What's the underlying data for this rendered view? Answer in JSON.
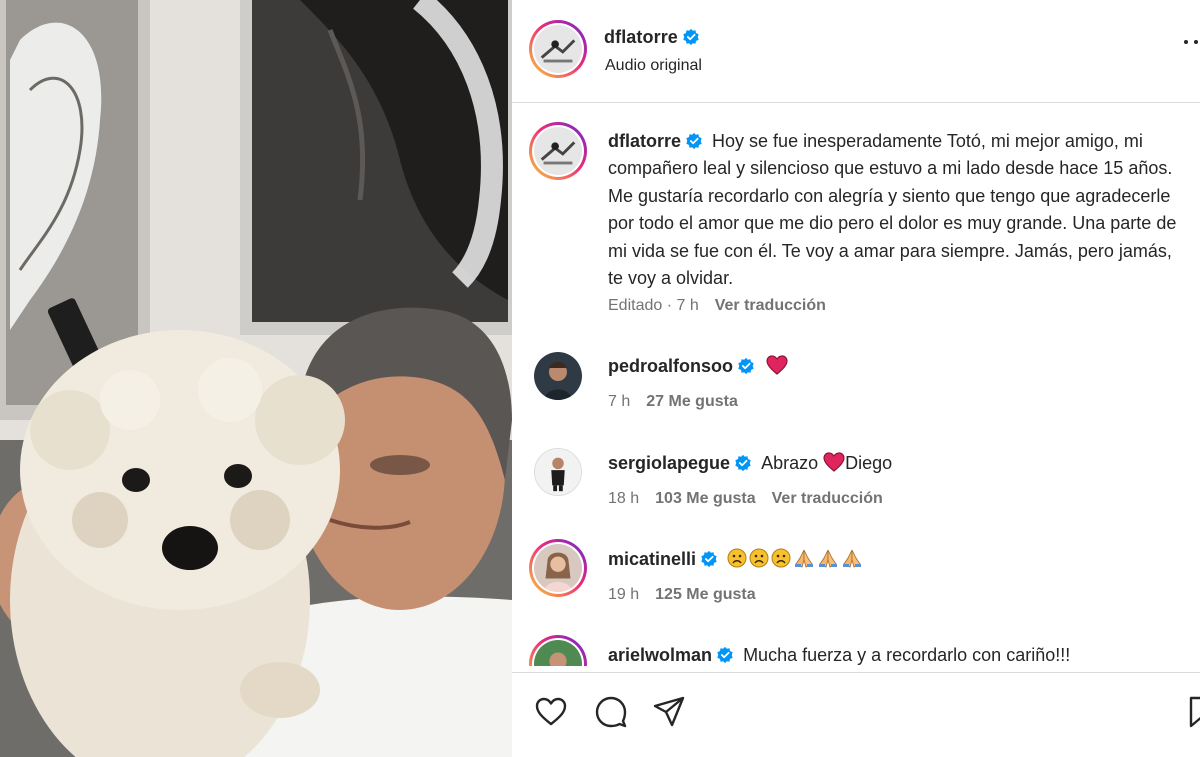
{
  "post": {
    "author": "dflatorre",
    "audio_label": "Audio original",
    "caption_author": "dflatorre",
    "caption_text": "Hoy se fue inesperadamente Totó, mi mejor amigo, mi compañero leal y silencioso que estuvo a mi lado desde hace 15 años. Me gustaría recordarlo con alegría y siento que tengo que agradecerle por todo el amor que me dio pero el dolor es muy grande. Una parte de mi vida se fue con él. Te voy a amar para siempre. Jamás, pero jamás, te voy a olvidar.",
    "edited_label": "Editado · 7 h",
    "translate_label": "Ver traducción"
  },
  "comments": [
    {
      "user": "pedroalfonsoo",
      "text": "",
      "time": "7 h",
      "likes": "27 Me gusta",
      "translate": ""
    },
    {
      "user": "sergiolapegue",
      "text_before": "Abrazo",
      "text_after": "Diego",
      "time": "18 h",
      "likes": "103 Me gusta",
      "translate": "Ver traducción"
    },
    {
      "user": "micatinelli",
      "text": "",
      "time": "19 h",
      "likes": "125 Me gusta",
      "translate": ""
    },
    {
      "user": "arielwolman",
      "text": "Mucha fuerza y a recordarlo con cariño!!!"
    }
  ],
  "icons": {
    "verified": "verified-badge-icon",
    "more": "more-options-icon",
    "like": "heart-outline-icon",
    "comment": "comment-bubble-icon",
    "share": "paper-plane-icon",
    "save": "bookmark-icon"
  },
  "colors": {
    "verified_blue": "#0095f6",
    "muted_text": "#737373",
    "heart_red": "#e0245e"
  }
}
